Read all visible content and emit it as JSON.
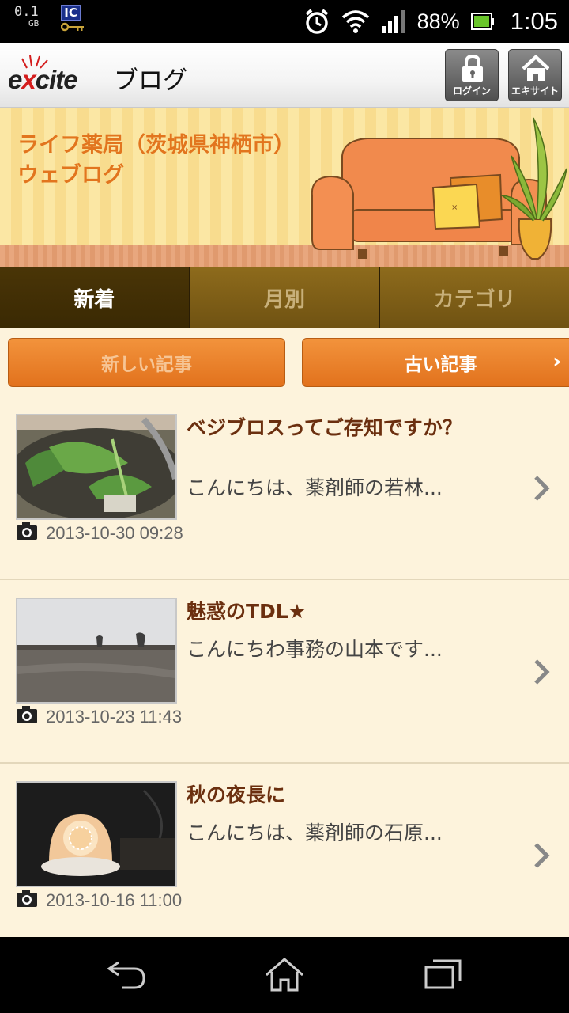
{
  "status_bar": {
    "data_value": "0.1",
    "data_unit": "GB",
    "ic_label": "IC",
    "battery_percent": "88%",
    "time": "1:05"
  },
  "header": {
    "logo_text_pre": "e",
    "logo_text_x": "x",
    "logo_text_post": "cite",
    "blog_label": "ブログ",
    "login_label": "ログイン",
    "excite_label": "エキサイト"
  },
  "banner": {
    "title_line1": "ライフ薬局（茨城県神栖市）",
    "title_line2": "ウェブログ"
  },
  "tabs": [
    {
      "label": "新着",
      "active": true
    },
    {
      "label": "月別",
      "active": false
    },
    {
      "label": "カテゴリ",
      "active": false
    }
  ],
  "pager": {
    "newer_label": "新しい記事",
    "older_label": "古い記事",
    "older_chevron": "›"
  },
  "posts": [
    {
      "title": "ベジブロスってご存知ですか？",
      "excerpt": "こんにちは、薬剤師の若林...",
      "date": "2013-10-30 09:28"
    },
    {
      "title": "魅惑のTDL★",
      "excerpt": "こんにちわ事務の山本です...",
      "date": "2013-10-23 11:43"
    },
    {
      "title": "秋の夜長に",
      "excerpt": "こんにちは、薬剤師の石原...",
      "date": "2013-10-16 11:00"
    }
  ],
  "icons": {
    "status": [
      "alarm-icon",
      "wifi-icon",
      "signal-icon",
      "battery-icon"
    ],
    "header": [
      "lock-icon",
      "home-icon"
    ],
    "nav": [
      "back-icon",
      "home-icon",
      "recent-apps-icon"
    ]
  },
  "colors": {
    "accent_orange": "#e2751e",
    "tab_bar": "#6f5212",
    "post_title": "#6b2f0f",
    "content_bg": "#fdf3dc"
  }
}
